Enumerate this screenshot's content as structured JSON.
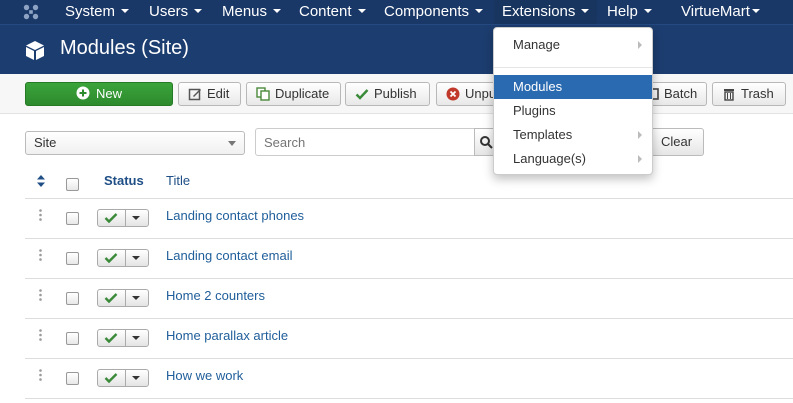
{
  "topnav": {
    "items": [
      {
        "label": "System"
      },
      {
        "label": "Users"
      },
      {
        "label": "Menus"
      },
      {
        "label": "Content"
      },
      {
        "label": "Components"
      },
      {
        "label": "Extensions"
      },
      {
        "label": "Help"
      },
      {
        "label": "VirtueMart"
      }
    ]
  },
  "header": {
    "title": "Modules (Site)"
  },
  "toolbar": {
    "new": "New",
    "edit": "Edit",
    "duplicate": "Duplicate",
    "publish": "Publish",
    "unpublish": "Unpu",
    "batch": "Batch",
    "trash": "Trash"
  },
  "filters": {
    "client_select": "Site",
    "search_placeholder": "Search",
    "clear": "Clear"
  },
  "table": {
    "headers": {
      "status": "Status",
      "title": "Title"
    },
    "rows": [
      {
        "title": "Landing contact phones"
      },
      {
        "title": "Landing contact email"
      },
      {
        "title": "Home 2 counters"
      },
      {
        "title": "Home parallax article"
      },
      {
        "title": "How we work"
      }
    ]
  },
  "extensions_menu": {
    "items": [
      {
        "label": "Manage"
      },
      {
        "label": "Modules"
      },
      {
        "label": "Plugins"
      },
      {
        "label": "Templates"
      },
      {
        "label": "Language(s)"
      }
    ]
  },
  "colors": {
    "navbar": "#1a3867",
    "header": "#1c3d6f",
    "new_button": "#34983a",
    "link": "#1f5e9a",
    "menu_selected": "#2a6ab0"
  }
}
